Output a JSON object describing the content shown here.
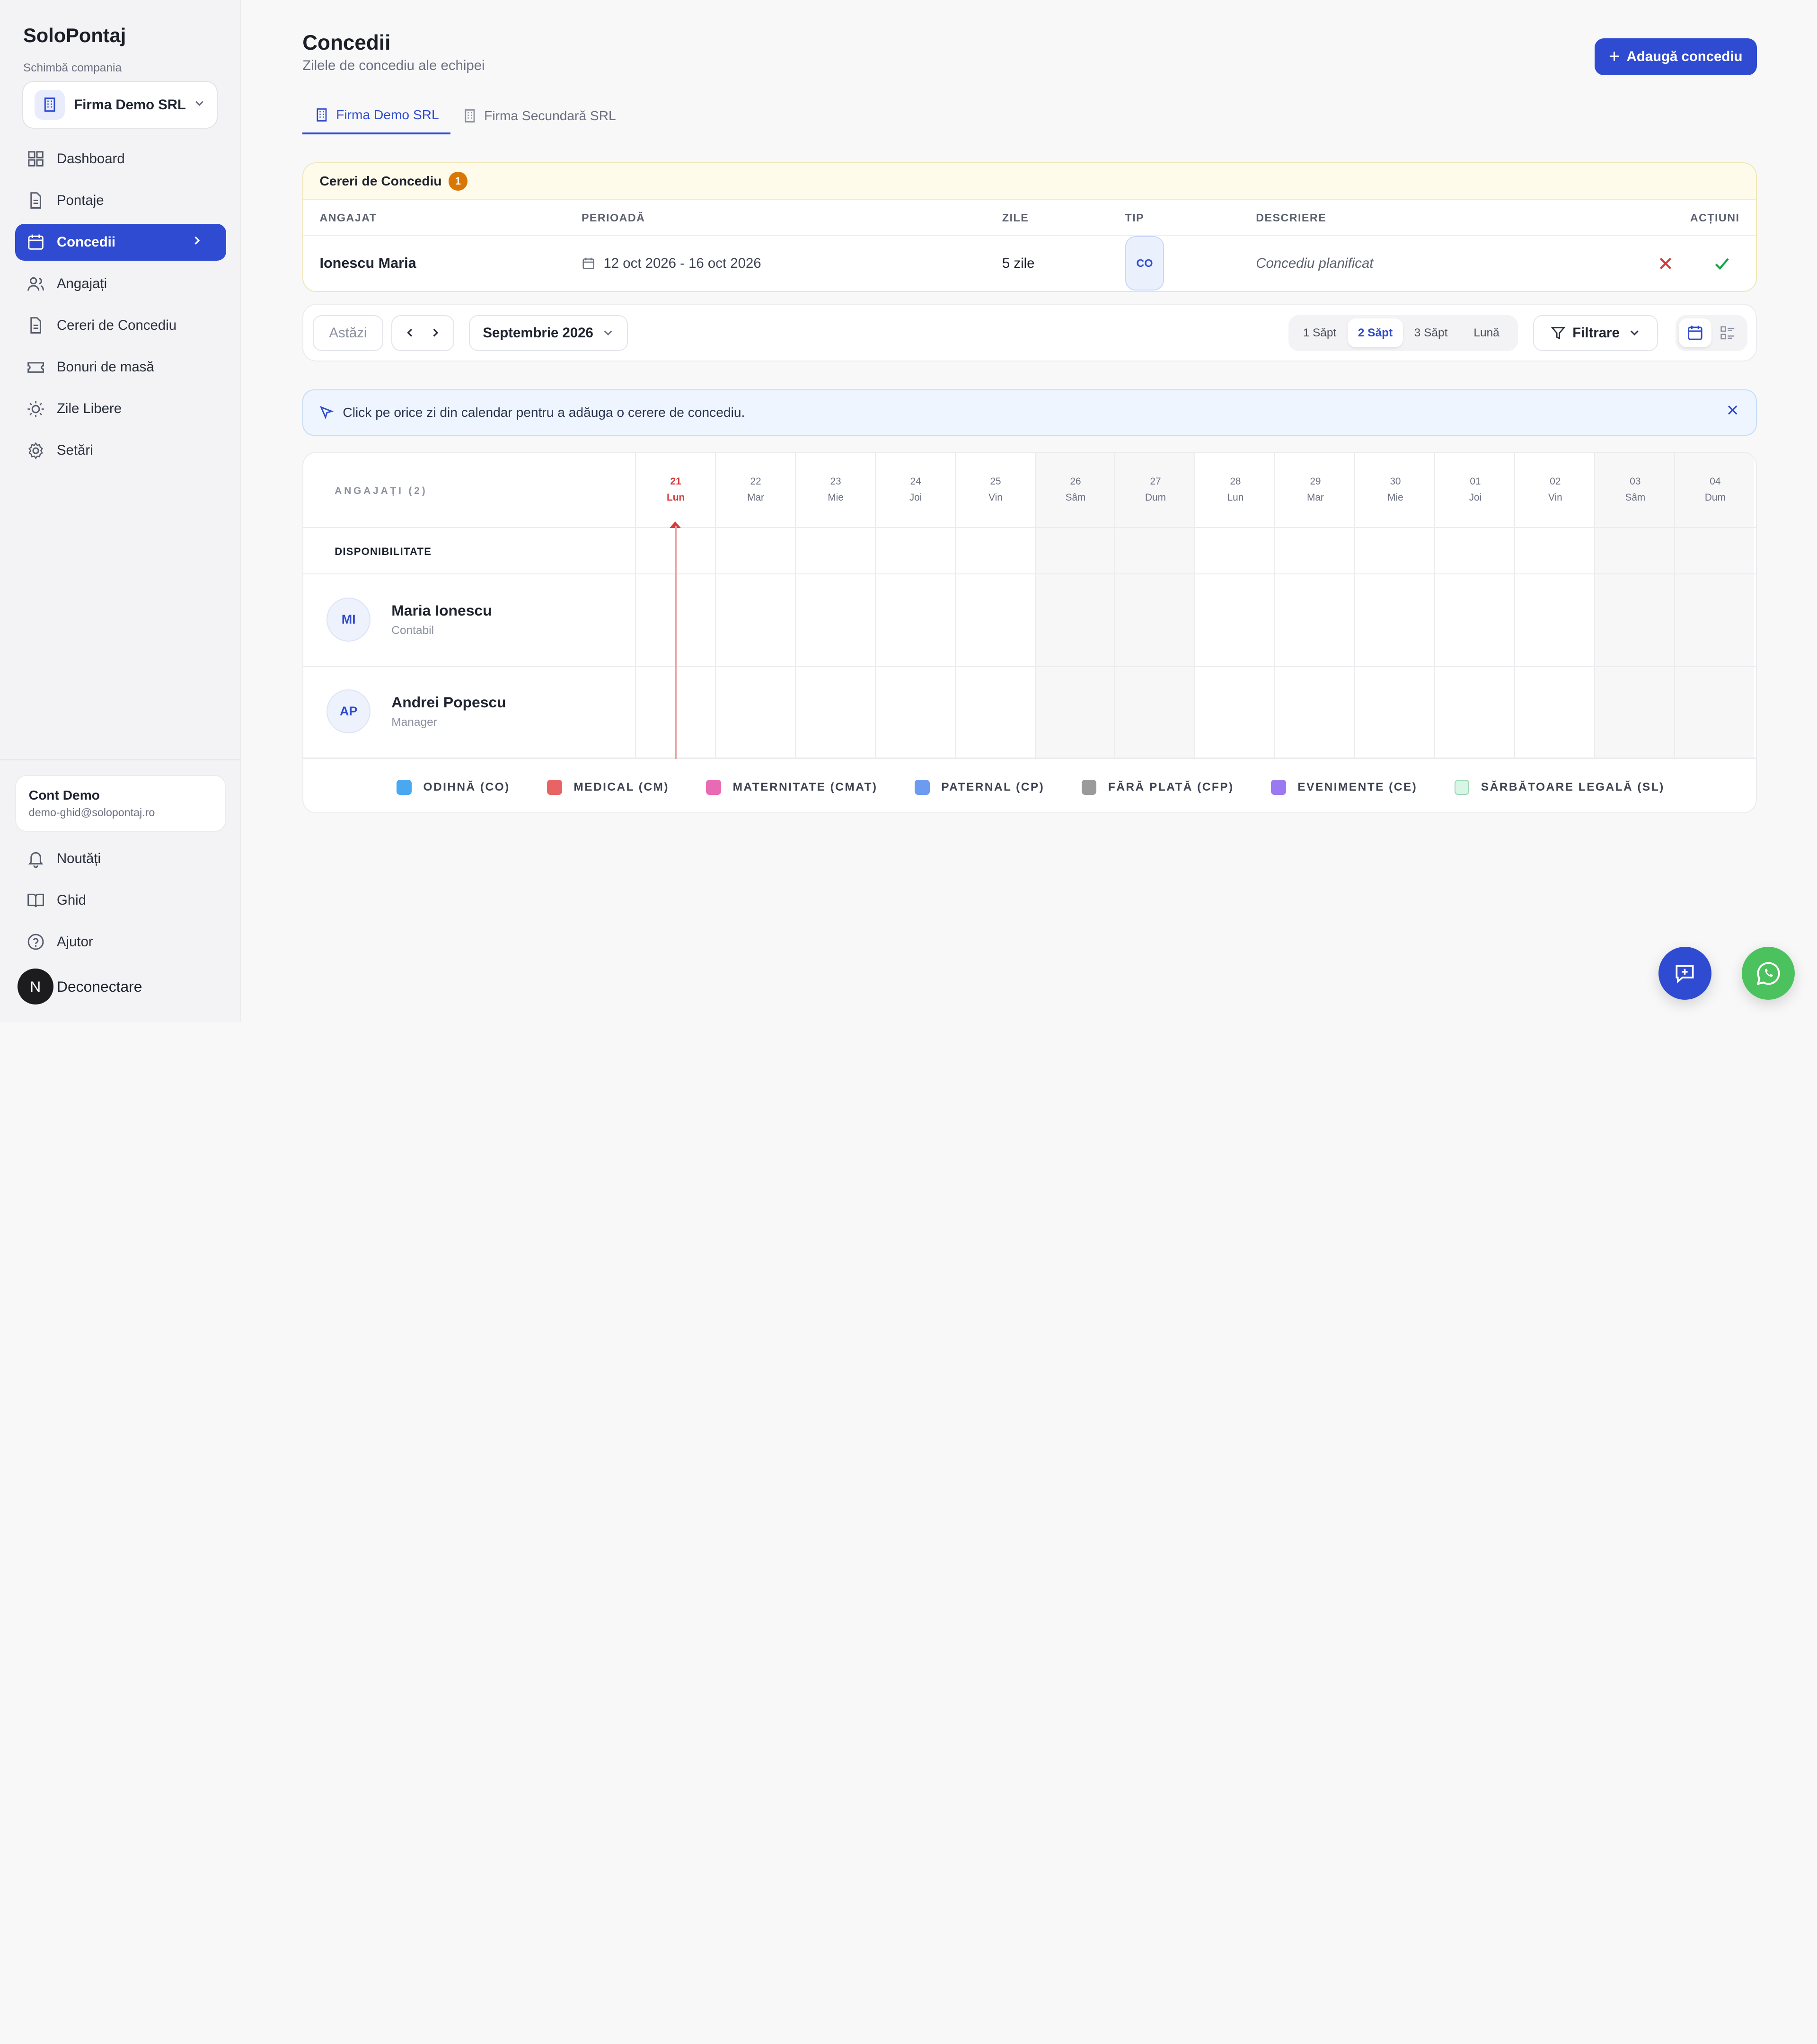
{
  "sidebar": {
    "brand": "SoloPontaj",
    "switch_label": "Schimbă compania",
    "company": "Firma Demo SRL",
    "items": [
      {
        "label": "Dashboard",
        "icon": "grid-icon"
      },
      {
        "label": "Pontaje",
        "icon": "document-icon"
      },
      {
        "label": "Concedii",
        "icon": "calendar-icon",
        "active": true
      },
      {
        "label": "Angajați",
        "icon": "users-icon"
      },
      {
        "label": "Cereri de Concediu",
        "icon": "document-icon"
      },
      {
        "label": "Bonuri de masă",
        "icon": "ticket-icon"
      },
      {
        "label": "Zile Libere",
        "icon": "sun-icon"
      },
      {
        "label": "Setări",
        "icon": "gear-icon"
      }
    ],
    "account": {
      "name": "Cont Demo",
      "email": "demo-ghid@solopontaj.ro"
    },
    "bottom": [
      {
        "label": "Noutăți",
        "icon": "bell-icon"
      },
      {
        "label": "Ghid",
        "icon": "book-icon"
      },
      {
        "label": "Ajutor",
        "icon": "help-icon"
      }
    ],
    "logout": "Deconectare",
    "logout_badge": "N"
  },
  "header": {
    "title": "Concedii",
    "subtitle": "Zilele de concediu ale echipei",
    "add_button": "Adaugă concediu"
  },
  "tabs": [
    {
      "label": "Firma Demo SRL",
      "active": true
    },
    {
      "label": "Firma Secundară SRL",
      "active": false
    }
  ],
  "requests": {
    "title": "Cereri de Concediu",
    "count": "1",
    "columns": [
      "ANGAJAT",
      "PERIOADĂ",
      "ZILE",
      "TIP",
      "DESCRIERE",
      "ACȚIUNI"
    ],
    "rows": [
      {
        "employee": "Ionescu Maria",
        "period": "12 oct 2026 - 16 oct 2026",
        "days": "5 zile",
        "type": "CO",
        "description": "Concediu planificat"
      }
    ]
  },
  "toolbar": {
    "today": "Astăzi",
    "month": "Septembrie 2026",
    "ranges": [
      "1 Săpt",
      "2 Săpt",
      "3 Săpt",
      "Lună"
    ],
    "active_range": "2 Săpt",
    "filter": "Filtrare"
  },
  "info": {
    "text": "Click pe orice zi din calendar pentru a adăuga o cerere de concediu."
  },
  "calendar": {
    "employees_header": "ANGAJAȚI (2)",
    "availability": "DISPONIBILITATE",
    "days": [
      {
        "num": "21",
        "name": "Lun",
        "today": true
      },
      {
        "num": "22",
        "name": "Mar"
      },
      {
        "num": "23",
        "name": "Mie"
      },
      {
        "num": "24",
        "name": "Joi"
      },
      {
        "num": "25",
        "name": "Vin"
      },
      {
        "num": "26",
        "name": "Sâm",
        "weekend": true
      },
      {
        "num": "27",
        "name": "Dum",
        "weekend": true
      },
      {
        "num": "28",
        "name": "Lun"
      },
      {
        "num": "29",
        "name": "Mar"
      },
      {
        "num": "30",
        "name": "Mie"
      },
      {
        "num": "01",
        "name": "Joi"
      },
      {
        "num": "02",
        "name": "Vin"
      },
      {
        "num": "03",
        "name": "Sâm",
        "weekend": true
      },
      {
        "num": "04",
        "name": "Dum",
        "weekend": true
      }
    ],
    "employees": [
      {
        "initials": "MI",
        "name": "Maria Ionescu",
        "role": "Contabil"
      },
      {
        "initials": "AP",
        "name": "Andrei Popescu",
        "role": "Manager"
      }
    ]
  },
  "legend": [
    {
      "label": "ODIHNĂ (CO)",
      "color": "#4aa8f0"
    },
    {
      "label": "MEDICAL (CM)",
      "color": "#e86464"
    },
    {
      "label": "MATERNITATE (CMAT)",
      "color": "#e86ab4"
    },
    {
      "label": "PATERNAL (CP)",
      "color": "#6b9cf0"
    },
    {
      "label": "FĂRĂ PLATĂ (CFP)",
      "color": "#9a9a9a"
    },
    {
      "label": "EVENIMENTE (CE)",
      "color": "#9a7af0"
    },
    {
      "label": "SĂRBĂTOARE LEGALĂ (SL)",
      "color": "#d8f5e6"
    }
  ],
  "colors": {
    "accent": "#2f4bd1",
    "whatsapp": "#4cc25e"
  }
}
